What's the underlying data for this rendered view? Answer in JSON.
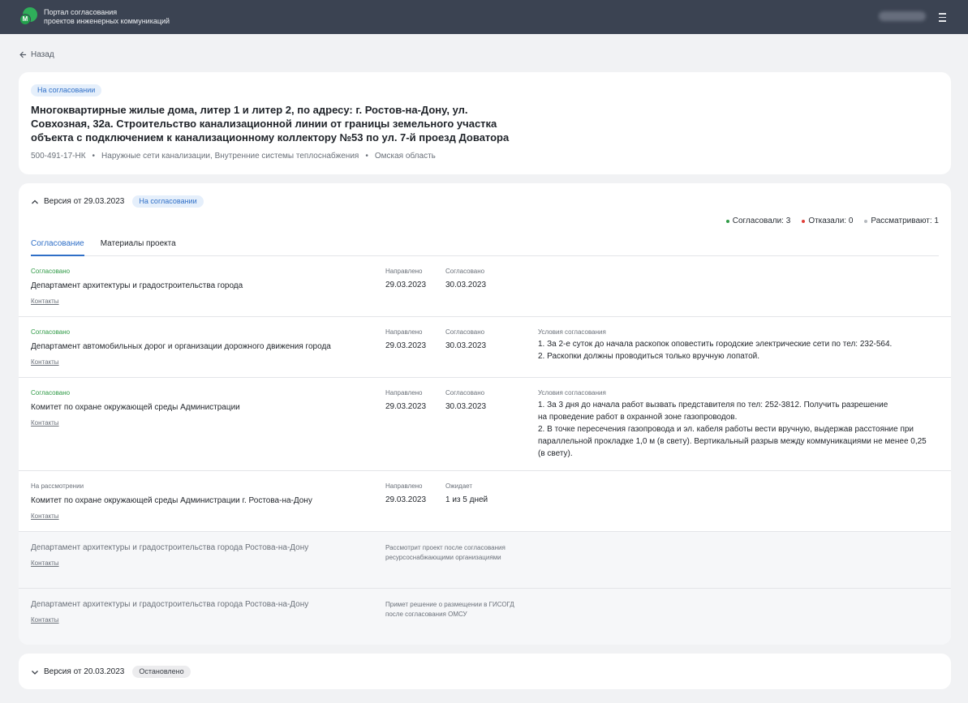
{
  "header": {
    "brand_line1": "Портал согласования",
    "brand_line2": "проектов инженерных коммуникаций",
    "logo_letter": "M",
    "menu_icon": "hamburger-menu-icon"
  },
  "nav": {
    "back_label": "Назад"
  },
  "project": {
    "status": "На согласовании",
    "title": "Многоквартирные жилые дома, литер 1 и литер 2, по адресу: г. Ростов-на-Дону, ул. Совхозная, 32а. Строительство канализационной линии от границы земельного участка объекта с подключением к канализационному коллектору №53 по ул. 7-й проезд Доватора",
    "code": "500-491-17-НК",
    "networks": "Наружные сети канализации, Внутренние системы теплоснабжения",
    "region": "Омская область",
    "separator": "•"
  },
  "current_version": {
    "label": "Версия от 29.03.2023",
    "status": "На согласовании",
    "stats": {
      "approved": "Согласовали: 3",
      "rejected": "Отказали: 0",
      "reviewing": "Рассматривают: 1",
      "approved_color": "#2f9a46",
      "rejected_color": "#e0403a",
      "reviewing_color": "#b5b9bf"
    },
    "tabs": [
      {
        "label": "Согласование",
        "active": true
      },
      {
        "label": "Материалы проекта",
        "active": false
      }
    ],
    "contacts_label": "Контакты",
    "rows": [
      {
        "status": "Согласовано",
        "org": "Департамент архитектуры и градостроительства города",
        "sent_label": "Направлено",
        "sent": "29.03.2023",
        "second_label": "Согласовано",
        "second": "30.03.2023"
      },
      {
        "status": "Согласовано",
        "org": "Департамент автомобильных дорог и организации дорожного движения города",
        "sent_label": "Направлено",
        "sent": "29.03.2023",
        "second_label": "Согласовано",
        "second": "30.03.2023",
        "conditions_label": "Условия согласования",
        "conditions": [
          "1. За 2-е суток до начала раскопок оповестить городские электрические сети по тел: 232-564.",
          "2. Раскопки должны проводиться только вручную лопатой."
        ]
      },
      {
        "status": "Согласовано",
        "org": "Комитет по охране окружающей среды Администрации",
        "sent_label": "Направлено",
        "sent": "29.03.2023",
        "second_label": "Согласовано",
        "second": "30.03.2023",
        "conditions_label": "Условия согласования",
        "conditions": [
          "1. За 3 дня до начала работ вызвать представителя по тел: 252-3812. Получить разрешение",
          "на проведение работ в охранной зоне газопроводов.",
          "2. В точке пересечения газопровода и эл. кабеля работы вести вручную, выдержав расстояние при",
          "параллельной прокладке 1,0 м (в свету). Вертикальный разрыв между коммуникациями не менее 0,25",
          "(в свету)."
        ]
      },
      {
        "status": "На рассмотрении",
        "org": "Комитет по охране окружающей среды Администрации г. Ростова-на-Дону",
        "sent_label": "Направлено",
        "sent": "29.03.2023",
        "second_label": "Ожидает",
        "second": "1 из 5 дней"
      },
      {
        "org": "Департамент архитектуры и градостроительства города Ростова-на-Дону",
        "note_line1": "Рассмотрит проект после согласования",
        "note_line2": "ресурсоснабжающими организациями"
      },
      {
        "org": "Департамент архитектуры и градостроительства города Ростова-на-Дону",
        "note_line1": "Примет решение о размещении в ГИСОГД",
        "note_line2": "после согласования ОМСУ"
      }
    ]
  },
  "previous_version": {
    "label": "Версия от 20.03.2023",
    "status": "Остановлено"
  }
}
